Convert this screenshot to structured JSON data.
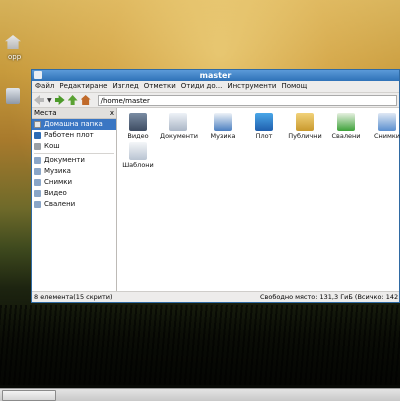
{
  "desktop": {
    "icons": [
      {
        "label": "орр"
      },
      {
        "label": ""
      }
    ]
  },
  "window": {
    "title": "master",
    "menu": [
      "Файл",
      "Редактиране",
      "Изглед",
      "Отметки",
      "Отиди до...",
      "Инструменти",
      "Помощ"
    ],
    "location": "/home/master",
    "sidebar": {
      "header": "Места",
      "close": "x",
      "places": [
        {
          "label": "Домашна папка",
          "selected": true
        },
        {
          "label": "Работен плот"
        },
        {
          "label": "Кош"
        }
      ],
      "bookmarks": [
        {
          "label": "Документи"
        },
        {
          "label": "Музика"
        },
        {
          "label": "Снимки"
        },
        {
          "label": "Видео"
        },
        {
          "label": "Свалени"
        }
      ]
    },
    "files": [
      {
        "label": "Видео",
        "icon": "video-folder-icon"
      },
      {
        "label": "Документи",
        "icon": "documents-folder-icon"
      },
      {
        "label": "Музика",
        "icon": "music-folder-icon"
      },
      {
        "label": "Плот",
        "icon": "desktop-folder-icon"
      },
      {
        "label": "Публични",
        "icon": "public-folder-icon"
      },
      {
        "label": "Свалени",
        "icon": "downloads-folder-icon"
      },
      {
        "label": "Снимки",
        "icon": "pictures-folder-icon"
      },
      {
        "label": "Шаблони",
        "icon": "templates-folder-icon"
      }
    ],
    "status": {
      "left": "8 елемента(15 скрити)",
      "right": "Свободно място: 131,3 ГиБ (Всичко: 142"
    }
  },
  "colors": {
    "titlebar": "#2f72b8",
    "selection": "#3a76c3"
  }
}
